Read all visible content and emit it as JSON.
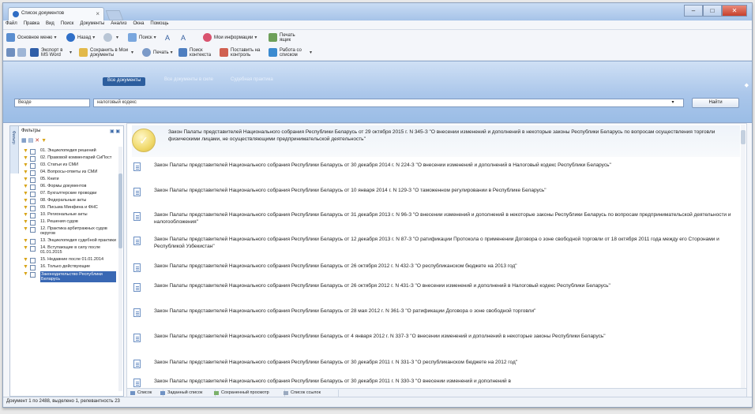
{
  "titlebar": {
    "tab_label": "Список документов",
    "min": "–",
    "max": "□",
    "close": "✕"
  },
  "menu": [
    "Файл",
    "Правка",
    "Вид",
    "Поиск",
    "Документы",
    "Анализ",
    "Окна",
    "Помощь"
  ],
  "toolbar1": {
    "home": "Основное меню",
    "back": "Назад",
    "search": "Поиск",
    "mark_a": "A",
    "mark_b": "A",
    "my_info": "Мои информации",
    "print_heading": "Печать",
    "print_sub": "ящик"
  },
  "toolbar2": {
    "export": "Экспорт в MS Word",
    "save": "Сохранить в Мои документы",
    "print": "Печать",
    "find_in_text": "Поиск контекста",
    "set_control": "Поставить на контроль",
    "work_with_list": "Работа со списком"
  },
  "search": {
    "tabs": [
      "Все документы",
      "Все документы в силе",
      "Судебная практика"
    ],
    "type_value": "Везде",
    "query_value": "налоговый кодекс",
    "find_button": "Найти"
  },
  "leftpanel": {
    "side_tab": "Фильтр",
    "title": "Фильтры",
    "items": [
      "01. Энциклопедия решений",
      "02. Правовой комментарий СиПост",
      "03. Статьи из СМИ",
      "04. Вопросы-ответы из СМИ",
      "05. Книги",
      "06. Формы документов",
      "07. Бухгалтерские проводки",
      "08. Федеральные акты",
      "09. Письма Минфина и ФНС",
      "10. Региональные акты",
      "11. Решения судов",
      "12. Практика арбитражных судов округов",
      "13. Энциклопедия судебной практики",
      "14. Вступающие в силу после 01.01.2015",
      "15. Недавние после 01.01.2014",
      "16. Только действующие",
      "Законодательство Республики Беларусь"
    ]
  },
  "documents": [
    "Закон Палаты представителей Национального собрания Республики Беларусь от 29 октября 2015 г. N 345-З \"О внесении изменений и дополнений в некоторые законы Республики Беларусь по вопросам осуществления торговли физическими лицами, не осуществляющими предпринимательской деятельность\"",
    "Закон Палаты представителей Национального собрания Республики Беларусь от 30 декабря 2014 г. N 224-З \"О внесении изменений и дополнений в Налоговый кодекс Республики Беларусь\"",
    "Закон Палаты представителей Национального собрания Республики Беларусь от 10 января 2014 г. N 129-З \"О таможенном регулировании в Республике Беларусь\"",
    "Закон Палаты представителей Национального собрания Республики Беларусь от 31 декабря 2013 г. N 96-З \"О внесении изменений и дополнений в некоторые законы Республики Беларусь по вопросам предпринимательской деятельности и налогообложения\"",
    "Закон Палаты представителей Национального собрания Республики Беларусь от 12 декабря 2013 г. N 87-З \"О ратификации Протокола о применении Договора о зоне свободной торговли от 18 октября 2011 года между его Сторонами и Республикой Узбекистан\"",
    "Закон Палаты представителей Национального собрания Республики Беларусь от 26 октября 2012 г. N 432-З \"О республиканском бюджете на 2013 год\"",
    "Закон Палаты представителей Национального собрания Республики Беларусь от 26 октября 2012 г. N 431-З \"О внесении изменений и дополнений в Налоговый кодекс Республики Беларусь\"",
    "Закон Палаты представителей Национального собрания Республики Беларусь от 28 мая 2012 г. N 361-З \"О ратификации Договора о зоне свободной торговли\"",
    "Закон Палаты представителей Национального собрания Республики Беларусь от 4 января 2012 г. N 337-З \"О внесении изменений и дополнений в некоторые законы Республики Беларусь\"",
    "Закон Палаты представителей Национального собрания Республики Беларусь от 30 декабря 2011 г. N 331-З \"О республиканском бюджете на 2012 год\"",
    "Закон Палаты представителей Национального собрания Республики Беларусь от 30 декабря 2011 г. N 330-З \"О внесении изменений и дополнений в"
  ],
  "bottom_tabs": [
    "Список",
    "Заданный список",
    "Сохраненный просмотр",
    "Список ссылок"
  ],
  "status": "Документ 1 по 2488, выделено 1, релевантность 23"
}
